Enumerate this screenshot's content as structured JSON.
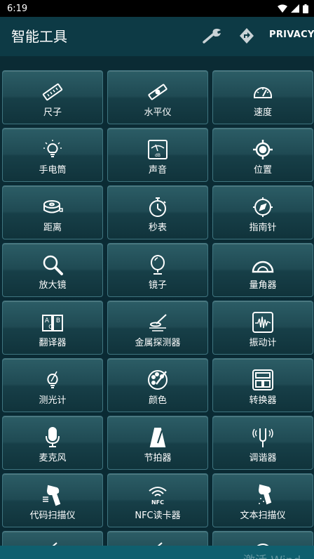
{
  "status_bar": {
    "time": "6:19"
  },
  "app_bar": {
    "title": "智能工具",
    "privacy_label": "PRIVACY"
  },
  "tools": [
    {
      "label": "尺子",
      "icon": "ruler-icon"
    },
    {
      "label": "水平仪",
      "icon": "spirit-level-icon"
    },
    {
      "label": "速度",
      "icon": "speedometer-icon"
    },
    {
      "label": "手电筒",
      "icon": "flashlight-icon"
    },
    {
      "label": "声音",
      "icon": "decibel-meter-icon"
    },
    {
      "label": "位置",
      "icon": "location-icon"
    },
    {
      "label": "距离",
      "icon": "tape-measure-icon"
    },
    {
      "label": "秒表",
      "icon": "stopwatch-icon"
    },
    {
      "label": "指南针",
      "icon": "compass-icon"
    },
    {
      "label": "放大镜",
      "icon": "magnifier-icon"
    },
    {
      "label": "镜子",
      "icon": "mirror-icon"
    },
    {
      "label": "量角器",
      "icon": "protractor-icon"
    },
    {
      "label": "翻译器",
      "icon": "translate-book-icon"
    },
    {
      "label": "金属探测器",
      "icon": "metal-detector-icon"
    },
    {
      "label": "振动计",
      "icon": "vibration-meter-icon"
    },
    {
      "label": "测光计",
      "icon": "light-meter-icon"
    },
    {
      "label": "颜色",
      "icon": "color-palette-icon"
    },
    {
      "label": "转换器",
      "icon": "unit-converter-icon"
    },
    {
      "label": "麦克风",
      "icon": "microphone-icon"
    },
    {
      "label": "节拍器",
      "icon": "metronome-icon"
    },
    {
      "label": "调谐器",
      "icon": "tuning-fork-icon"
    },
    {
      "label": "代码扫描仪",
      "icon": "barcode-scanner-icon"
    },
    {
      "label": "NFC读卡器",
      "icon": "nfc-icon"
    },
    {
      "label": "文本扫描仪",
      "icon": "text-scanner-icon"
    }
  ],
  "partial_row_icons": [
    "unknown-tool-icon",
    "unknown-tool-icon",
    "globe-icon"
  ],
  "watermark": "激活 Wind"
}
